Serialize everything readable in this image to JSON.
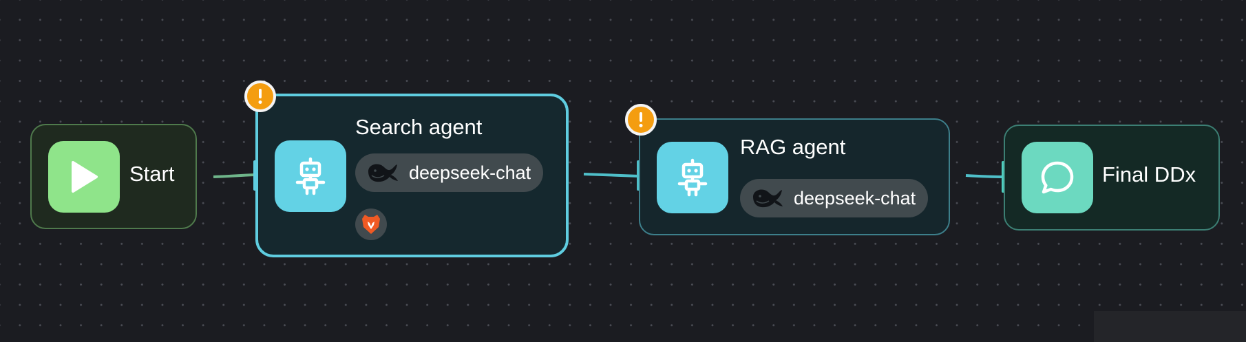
{
  "canvas": {
    "background": "#1b1c21"
  },
  "nodes": {
    "start": {
      "title": "Start",
      "icon": "play-icon",
      "color": "#8fe48a"
    },
    "search_agent": {
      "title": "Search agent",
      "icon": "robot-icon",
      "color": "#63d2e5",
      "model": "deepseek-chat",
      "model_icon": "deepseek-whale-icon",
      "tools": [
        "brave-lion-icon"
      ],
      "warning": true,
      "warning_icon": "exclamation-icon",
      "selected": true
    },
    "rag_agent": {
      "title": "RAG agent",
      "icon": "robot-icon",
      "color": "#63d2e5",
      "model": "deepseek-chat",
      "model_icon": "deepseek-whale-icon",
      "warning": true,
      "warning_icon": "exclamation-icon"
    },
    "final": {
      "title": "Final DDx",
      "icon": "chat-bubble-icon",
      "color": "#6cd9c0"
    }
  },
  "edges": [
    {
      "from": "start",
      "to": "search_agent"
    },
    {
      "from": "search_agent",
      "to": "rag_agent"
    },
    {
      "from": "rag_agent",
      "to": "final"
    }
  ],
  "colors": {
    "accent": "#5fcde0",
    "warning": "#f49d10",
    "edge_start": "#6fb58a",
    "edge": "#4fbfc9"
  }
}
